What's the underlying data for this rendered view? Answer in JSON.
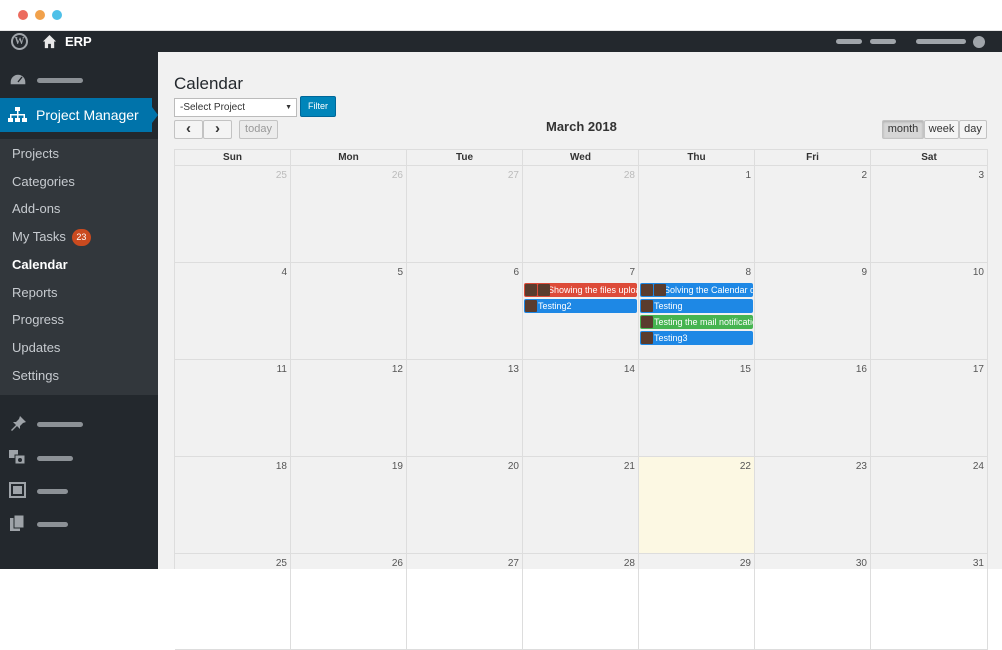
{
  "window": {
    "dots": [
      "#ec6b5e",
      "#f1a14b",
      "#4ec0e8"
    ]
  },
  "adminbar": {
    "site_name": "ERP",
    "icons": {
      "wp": "wordpress-icon",
      "home": "home-icon"
    }
  },
  "sidebar": {
    "active_menu": "Project Manager",
    "submenu": [
      {
        "label": "Projects"
      },
      {
        "label": "Categories"
      },
      {
        "label": "Add-ons"
      },
      {
        "label": "My Tasks",
        "badge": "23"
      },
      {
        "label": "Calendar",
        "current": true
      },
      {
        "label": "Reports"
      },
      {
        "label": "Progress"
      },
      {
        "label": "Updates"
      },
      {
        "label": "Settings"
      }
    ],
    "icons": [
      "dashboard-icon",
      "sitemap-icon",
      "pin-icon",
      "media-icon",
      "pages-icon",
      "copy-icon"
    ]
  },
  "page": {
    "title": "Calendar"
  },
  "filter": {
    "select_value": "-Select Project",
    "button": "Filter"
  },
  "toolbar": {
    "prev": "‹",
    "next": "›",
    "today": "today",
    "title": "March 2018",
    "views": [
      "month",
      "week",
      "day"
    ],
    "active_view": "month"
  },
  "calendar": {
    "days_of_week": [
      "Sun",
      "Mon",
      "Tue",
      "Wed",
      "Thu",
      "Fri",
      "Sat"
    ],
    "weeks": [
      [
        "25",
        "26",
        "27",
        "28",
        "1",
        "2",
        "3"
      ],
      [
        "4",
        "5",
        "6",
        "7",
        "8",
        "9",
        "10"
      ],
      [
        "11",
        "12",
        "13",
        "14",
        "15",
        "16",
        "17"
      ],
      [
        "18",
        "19",
        "20",
        "21",
        "22",
        "23",
        "24"
      ],
      [
        "25",
        "26",
        "27",
        "28",
        "29",
        "30",
        "31"
      ]
    ],
    "other_month_first_row": [
      0,
      1,
      2,
      3
    ],
    "today": "22",
    "events": [
      {
        "text": "Showing the files upload fi",
        "week": 1,
        "day": 3,
        "slot": 0,
        "color": "#dd4b39",
        "avatars": 2
      },
      {
        "text": "Testing2",
        "week": 1,
        "day": 3,
        "slot": 1,
        "color": "#1e88e5",
        "avatars": 1
      },
      {
        "text": "Solving the Calendar du",
        "week": 1,
        "day": 4,
        "slot": 0,
        "color": "#1e88e5",
        "avatars": 2
      },
      {
        "text": "Testing",
        "week": 1,
        "day": 4,
        "slot": 1,
        "color": "#1e88e5",
        "avatars": 1
      },
      {
        "text": "Testing the mail notificatio",
        "week": 1,
        "day": 4,
        "slot": 2,
        "color": "#46b450",
        "avatars": 1
      },
      {
        "text": "Testing3",
        "week": 1,
        "day": 4,
        "slot": 3,
        "color": "#1e88e5",
        "avatars": 1
      }
    ]
  }
}
